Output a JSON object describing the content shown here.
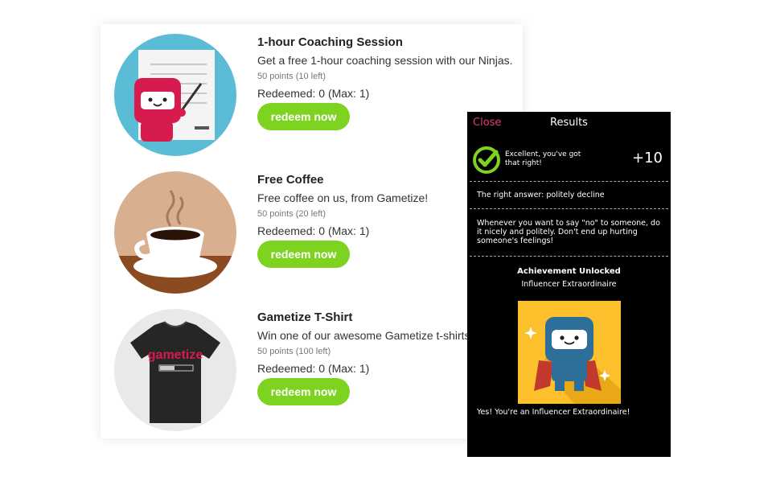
{
  "rewards": [
    {
      "title": "1-hour Coaching Session",
      "description": "Get a free 1-hour coaching session with our Ninjas.",
      "points": "50 points (10 left)",
      "redeemed": "Redeemed: 0 (Max: 1)",
      "button": "redeem now",
      "icon": "ninja-coach-icon"
    },
    {
      "title": "Free Coffee",
      "description": "Free coffee on us, from Gametize!",
      "points": "50 points (20 left)",
      "redeemed": "Redeemed: 0 (Max: 1)",
      "button": "redeem now",
      "icon": "coffee-cup-icon"
    },
    {
      "title": "Gametize T-Shirt",
      "description": "Win one of our awesome Gametize t-shirts!",
      "points": "50 points (100 left)",
      "redeemed": "Redeemed: 0 (Max: 1)",
      "button": "redeem now",
      "icon": "tshirt-icon",
      "shirt_text": "gametize"
    }
  ],
  "results": {
    "close": "Close",
    "title": "Results",
    "message": "Excellent, you've got that right!",
    "score": "+10",
    "answer": "The right answer: politely decline",
    "explanation": "Whenever you want to say \"no\" to someone, do it nicely and politely. Don't end up hurting someone's feelings!",
    "achievement_title": "Achievement Unlocked",
    "achievement_name": "Influencer Extraordinaire",
    "achievement_message": "Yes! You're an Influencer Extraordinaire!",
    "badge_icon": "superhero-ninja-icon",
    "check_icon": "check-circle-icon"
  },
  "colors": {
    "accent_green": "#7ed321",
    "close_pink": "#e0406e",
    "ninja_red": "#d81b4f",
    "badge_yellow": "#fcc02d"
  }
}
